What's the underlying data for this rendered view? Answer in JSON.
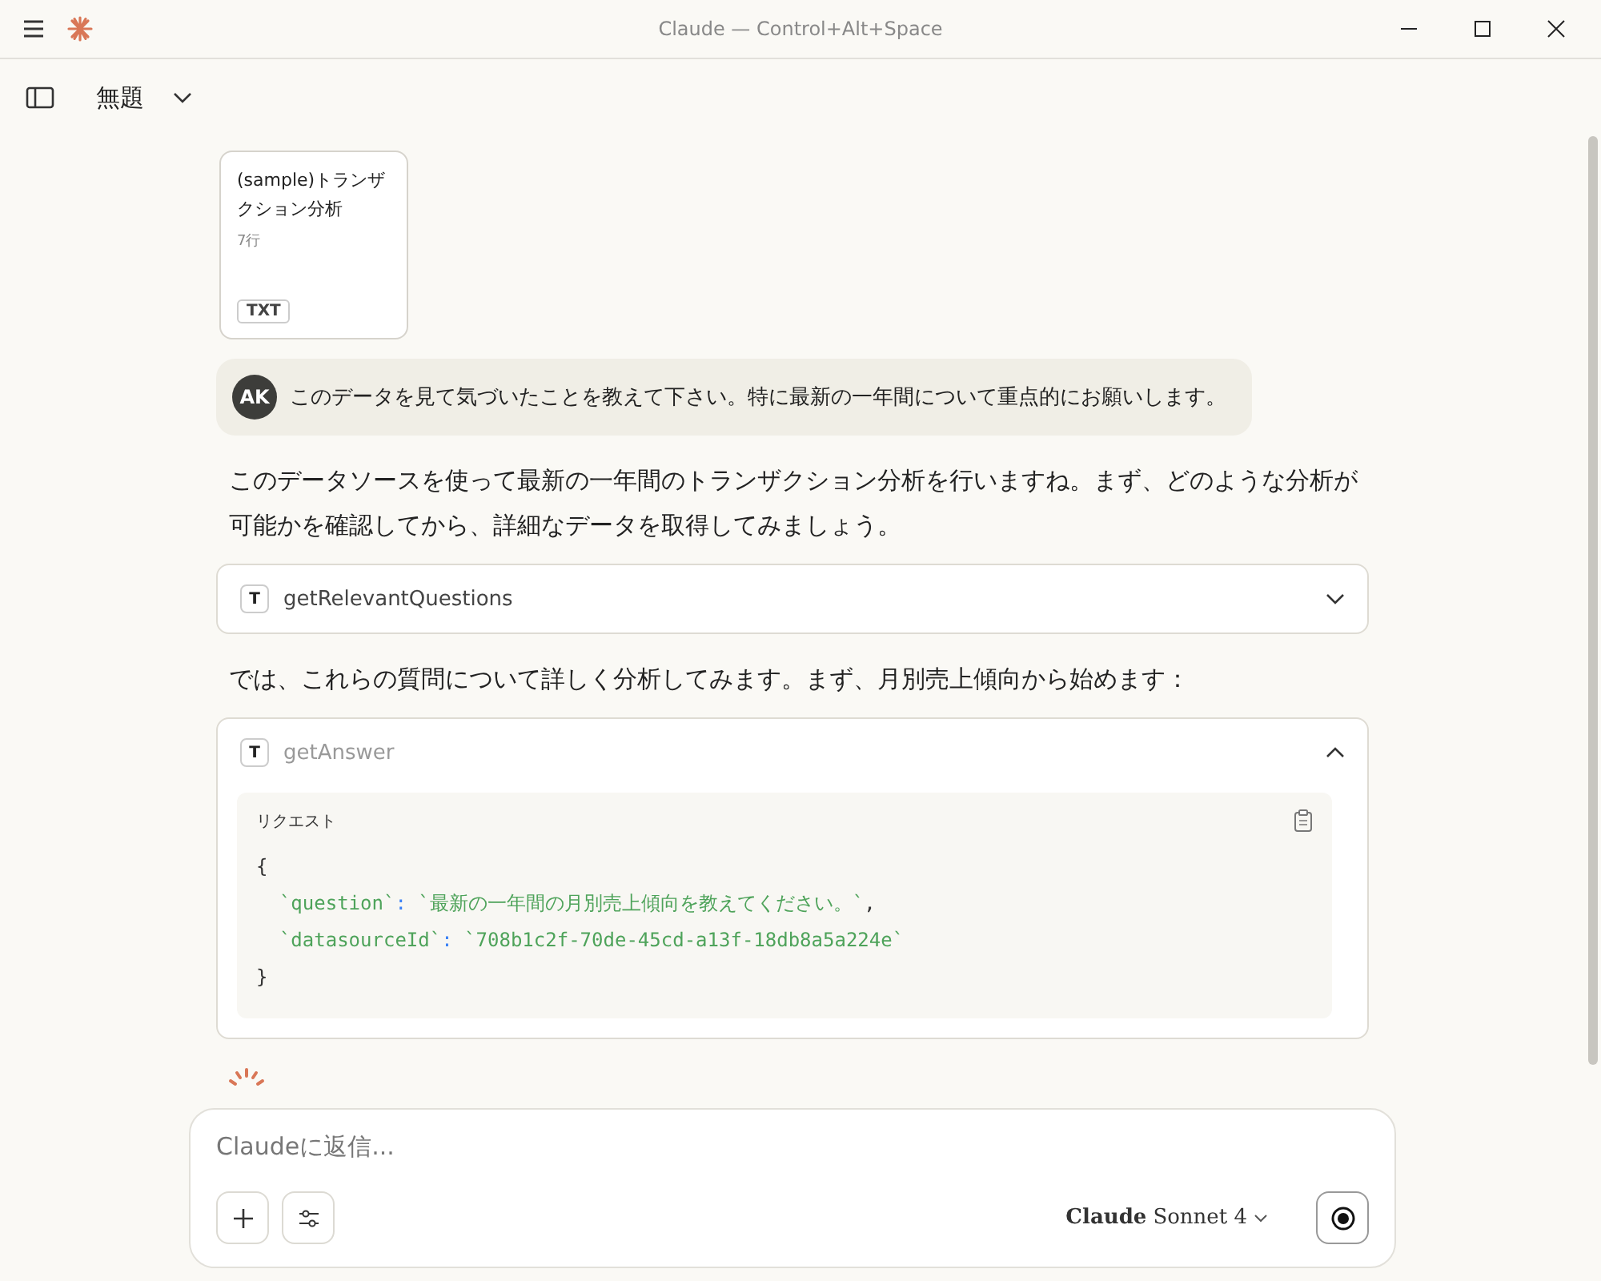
{
  "window": {
    "title": "Claude — Control+Alt+Space"
  },
  "header": {
    "chat_title": "無題"
  },
  "attachment": {
    "name": "(sample)トランザクション分析",
    "meta": "7行",
    "type": "TXT"
  },
  "user_message": {
    "avatar": "AK",
    "text": "このデータを見て気づいたことを教えて下さい。特に最新の一年間について重点的にお願いします。"
  },
  "messages": [
    {
      "kind": "text",
      "text": "このデータソースを使って最新の一年間のトランザクション分析を行いますね。まず、どのような分析が可能かを確認してから、詳細なデータを取得してみましょう。"
    },
    {
      "kind": "tool",
      "badge": "T",
      "name": "getRelevantQuestions",
      "expanded": false
    },
    {
      "kind": "text",
      "text": "では、これらの質問について詳しく分析してみます。まず、月別売上傾向から始めます："
    },
    {
      "kind": "tool",
      "badge": "T",
      "name": "getAnswer",
      "expanded": true,
      "request_label": "リクエスト",
      "code": [
        [
          {
            "kind": "punct",
            "text": "{"
          }
        ],
        [
          {
            "kind": "key",
            "text": "  `question`"
          },
          {
            "kind": "colon",
            "text": ": "
          },
          {
            "kind": "string",
            "text": "`最新の一年間の月別売上傾向を教えてください。`"
          },
          {
            "kind": "punct",
            "text": ","
          }
        ],
        [
          {
            "kind": "key",
            "text": "  `datasourceId`"
          },
          {
            "kind": "colon",
            "text": ": "
          },
          {
            "kind": "string",
            "text": "`708b1c2f-70de-45cd-a13f-18db8a5a224e`"
          }
        ],
        [
          {
            "kind": "punct",
            "text": "}"
          }
        ]
      ]
    }
  ],
  "composer": {
    "placeholder": "Claudeに返信...",
    "model": "**Claude** Sonnet 4"
  }
}
